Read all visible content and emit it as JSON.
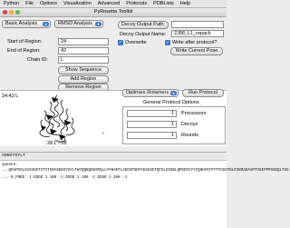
{
  "menu": [
    "Python",
    "File",
    "Options",
    "Visualization",
    "Advanced",
    "Protocols",
    "PDBLists",
    "Help"
  ],
  "window": {
    "title": "PyRosetta Toolkit"
  },
  "left": {
    "analysis_combo": "Basic Analysis",
    "rmsd_combo": "RMSD Analysis",
    "start_label": "Start of Region:",
    "start_value": "24",
    "end_label": "End of Region:",
    "end_value": "42",
    "chain_label": "Chain ID:",
    "chain_value": "L",
    "show_sequence": "Show Sequence",
    "add_region": "Add Region",
    "remove_region": "Remove Region"
  },
  "right": {
    "decoy_output_path_btn": "Decoy Output Path:",
    "decoy_output_name_label": "Decoy Output Name:",
    "decoy_output_name_value": "2J88_L1_repack",
    "overwrite_label": "Overwrite",
    "write_after_label": "Write after protocol?",
    "write_current_pose": "Write Current Pose"
  },
  "viewer": {
    "region_text": "24:42:L",
    "pose_label": "28 L - 28"
  },
  "protocol": {
    "optimize_combo": "Optimize Rotamers",
    "run_button": "Run Protocol",
    "options_title": "General Protocol Options",
    "rows": [
      {
        "value": "1",
        "label": "Processors"
      },
      {
        "value": "1",
        "label": "Decoys"
      },
      {
        "value": "1",
        "label": "Rounds"
      }
    ]
  },
  "sequence": {
    "header_text": "ADNIYSYLT",
    "line_label": "quence:",
    "seq_line": "...QSAPSSLSASVGETVTITCRASENIYSYLTWYQQKQGKSPQLLVYNAKTLAEGVPSRFSGSGSGTQFSLKINSLQPEDFGYYCQHHYGTPYTFGGGTKLEIKRADAAPTVSIFPPSSEQLTSG",
    "bottom_line": "... 0_FREE: 1 EDGE 1 105 -1 EDGE 1 106 -1 EDGE 1 108 -1"
  }
}
